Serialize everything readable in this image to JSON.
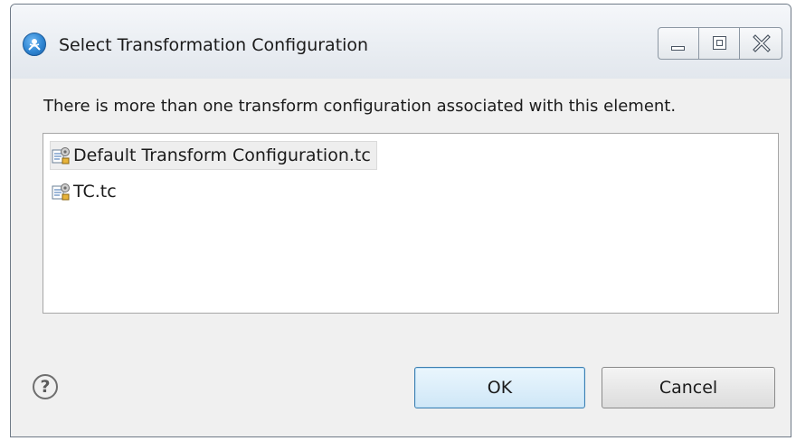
{
  "window": {
    "title": "Select Transformation Configuration",
    "controls": {
      "minimize": "minimize-icon",
      "maximize": "maximize-icon",
      "close": "close-icon"
    }
  },
  "dialog": {
    "message": "There is more than one transform configuration associated with this element.",
    "items": [
      {
        "label": "Default Transform Configuration.tc",
        "selected": true,
        "icon": "transform-config-icon"
      },
      {
        "label": "TC.tc",
        "selected": false,
        "icon": "transform-config-icon"
      }
    ],
    "help_icon": "help-icon",
    "ok_label": "OK",
    "cancel_label": "Cancel"
  },
  "colors": {
    "window_bg": "#f0f0f0",
    "ok_border": "#3c7fb1",
    "selection_bg": "#eeeeee"
  }
}
